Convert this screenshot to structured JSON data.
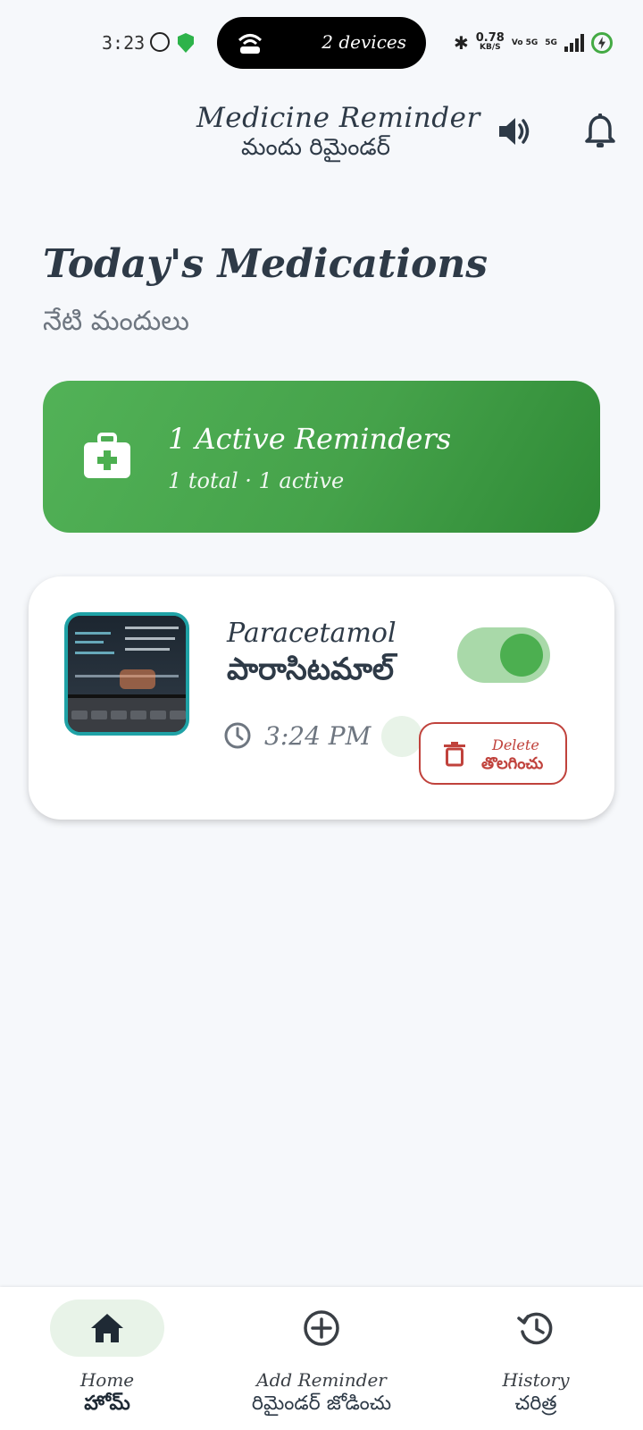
{
  "status_bar": {
    "time": "3:23",
    "pill_text": "2 devices",
    "net_speed": "0.78",
    "net_unit": "KB/S",
    "network_type": "5G",
    "volte": "Vo 5G"
  },
  "header": {
    "title": "Medicine Reminder",
    "subtitle": "మందు రిమైండర్"
  },
  "section": {
    "title": "Today's Medications",
    "subtitle": "నేటి మందులు"
  },
  "summary": {
    "title": "1 Active Reminders",
    "subtitle": "1 total · 1 active"
  },
  "medication": {
    "name_en": "Paracetamol",
    "name_te": "పారాసిటమాల్",
    "time": "3:24 PM",
    "enabled": true,
    "delete_en": "Delete",
    "delete_te": "తొలగించు"
  },
  "nav": {
    "home_en": "Home",
    "home_te": "హోమ్",
    "add_en": "Add Reminder",
    "add_te": "రిమైండర్ జోడించు",
    "history_en": "History",
    "history_te": "చరిత్ర"
  },
  "colors": {
    "accent": "#4caf50",
    "danger": "#c0423c",
    "text": "#2e3a47",
    "background": "#f6f8fb"
  },
  "icons": {
    "header": [
      "speaker-icon",
      "bell-icon"
    ],
    "summary": "medical-kit-icon",
    "card": [
      "clock-icon",
      "trash-icon"
    ],
    "nav": [
      "home-icon",
      "add-circle-icon",
      "history-icon"
    ]
  }
}
